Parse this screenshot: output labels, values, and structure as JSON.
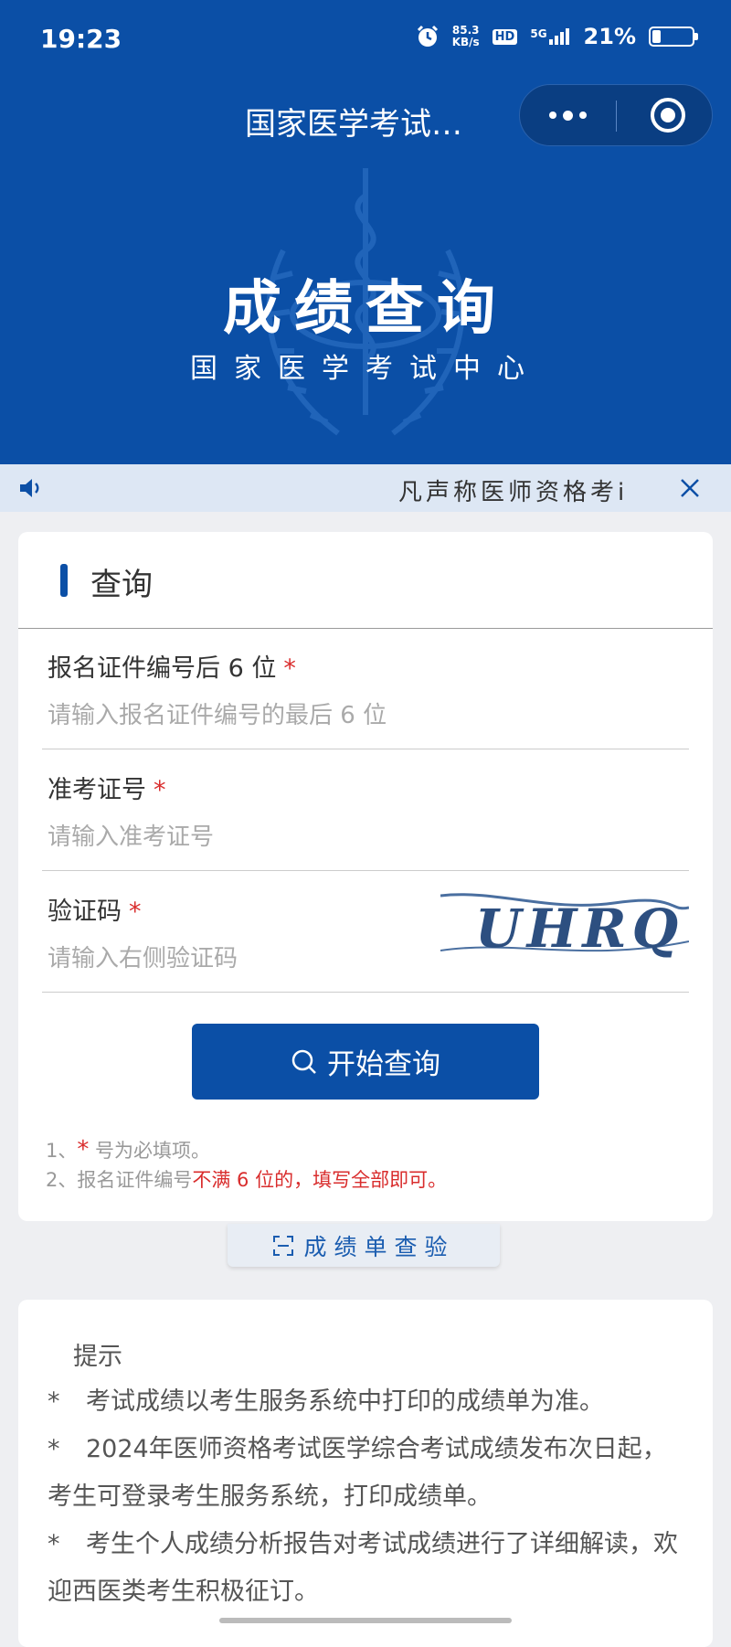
{
  "status_bar": {
    "time": "19:23",
    "net_speed": "85.3",
    "net_unit": "KB/s",
    "hd": "HD",
    "signal": "5G",
    "battery": "21%",
    "battery_level": 0.21
  },
  "header": {
    "nav_title": "国家医学考试…",
    "hero_title": "成绩查询",
    "hero_subtitle": "国家医学考试中心"
  },
  "notice": {
    "text": "凡声称医师资格考i"
  },
  "query_card": {
    "title": "查询",
    "fields": [
      {
        "label": "报名证件编号后 6 位",
        "required_mark": "*",
        "placeholder": "请输入报名证件编号的最后 6 位"
      },
      {
        "label": "准考证号",
        "required_mark": "*",
        "placeholder": "请输入准考证号"
      },
      {
        "label": "验证码",
        "required_mark": "*",
        "placeholder": "请输入右侧验证码"
      }
    ],
    "captcha_text": "UHRQ",
    "submit_label": "开始查询",
    "notes": {
      "line1_prefix": "1、",
      "line1_star": "*",
      "line1_suffix": " 号为必填项。",
      "line2_prefix": "2、报名证件编号",
      "line2_red": "不满 6 位的，填写全部即可。"
    }
  },
  "verify_button": {
    "label": "成绩单查验"
  },
  "tips": {
    "title": "提示",
    "items": [
      {
        "star": "*",
        "text": "考试成绩以考生服务系统中打印的成绩单为准。"
      },
      {
        "star": "*",
        "text": "2024年医师资格考试医学综合考试成绩发布次日起，考生可登录考生服务系统，打印成绩单。"
      },
      {
        "star": "*",
        "text": "考生个人成绩分析报告对考试成绩进行了详细解读，欢迎西医类考生积极征订。"
      }
    ]
  },
  "colors": {
    "primary": "#0b4fa6",
    "required": "#d92d2d",
    "notice_bg": "#dde7f4"
  }
}
